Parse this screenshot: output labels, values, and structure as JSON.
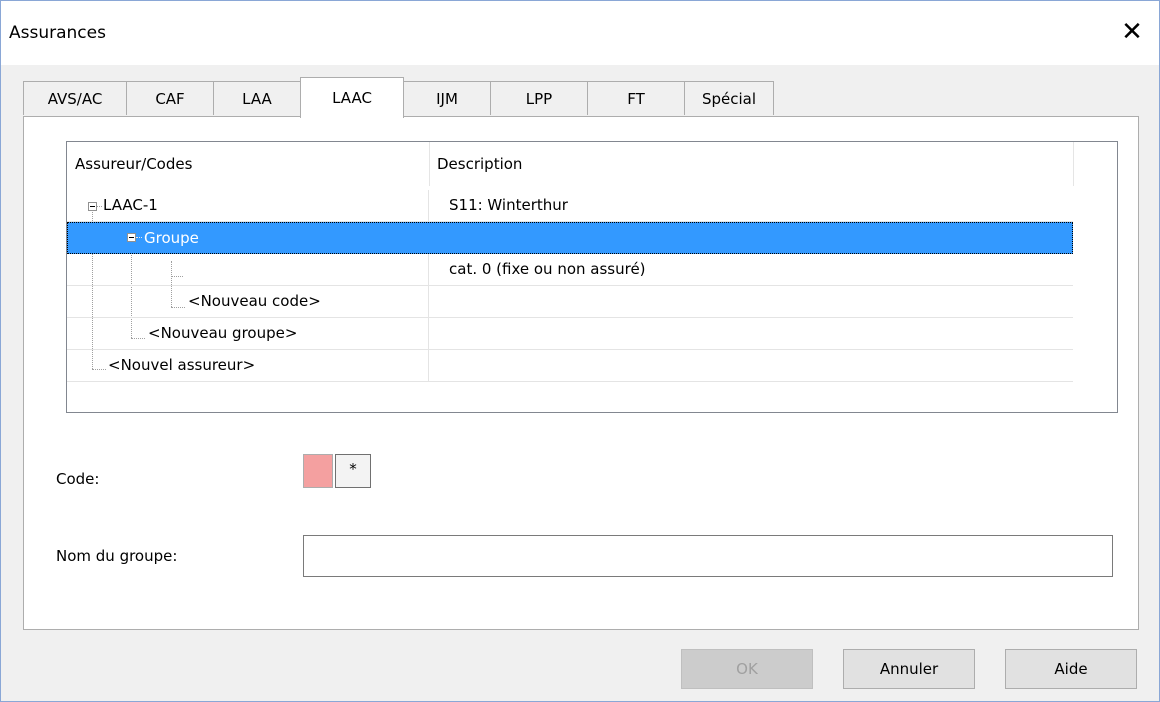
{
  "window": {
    "title": "Assurances",
    "close_glyph": "✕"
  },
  "tabs": [
    {
      "label": "AVS/AC"
    },
    {
      "label": "CAF"
    },
    {
      "label": "LAA"
    },
    {
      "label": "LAAC",
      "active": true
    },
    {
      "label": "IJM"
    },
    {
      "label": "LPP"
    },
    {
      "label": "FT"
    },
    {
      "label": "Spécial"
    }
  ],
  "grid": {
    "columns": [
      "Assureur/Codes",
      "Description"
    ],
    "rows": [
      {
        "label": "LAAC-1",
        "description": "S11: Winterthur"
      },
      {
        "label": "Groupe",
        "description": "",
        "selected": true
      },
      {
        "label": "",
        "description": "cat. 0 (fixe ou non assuré)"
      },
      {
        "label": "<Nouveau code>",
        "description": ""
      },
      {
        "label": "<Nouveau groupe>",
        "description": ""
      },
      {
        "label": "<Nouvel assureur>",
        "description": ""
      }
    ]
  },
  "form": {
    "code_label": "Code:",
    "code_color": "#f4a0a0",
    "code_button": "*",
    "group_name_label": "Nom du groupe:",
    "group_name_value": ""
  },
  "buttons": {
    "ok": "OK",
    "cancel": "Annuler",
    "help": "Aide"
  },
  "colors": {
    "selection": "#3399ff",
    "border_accent": "#8aa7d6"
  }
}
